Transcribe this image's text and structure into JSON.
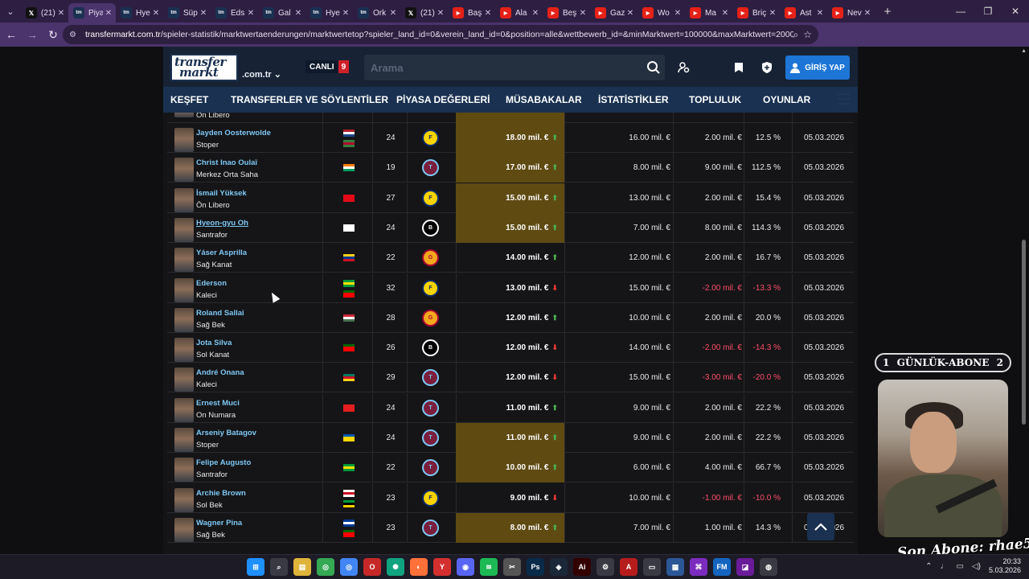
{
  "browser": {
    "tabs": [
      {
        "label": "(21)",
        "icon": "x-icon"
      },
      {
        "label": "Piya",
        "icon": "transfermarkt-icon",
        "active": true
      },
      {
        "label": "Hye",
        "icon": "transfermarkt-icon"
      },
      {
        "label": "Süp",
        "icon": "transfermarkt-icon"
      },
      {
        "label": "Eds",
        "icon": "transfermarkt-icon"
      },
      {
        "label": "Gal",
        "icon": "transfermarkt-icon"
      },
      {
        "label": "Hye",
        "icon": "transfermarkt-icon"
      },
      {
        "label": "Ork",
        "icon": "transfermarkt-icon"
      },
      {
        "label": "(21)",
        "icon": "x-icon"
      },
      {
        "label": "Baş",
        "icon": "youtube-icon"
      },
      {
        "label": "Ala",
        "icon": "youtube-icon"
      },
      {
        "label": "Beş",
        "icon": "youtube-icon"
      },
      {
        "label": "Gaz",
        "icon": "youtube-icon"
      },
      {
        "label": "Wo",
        "icon": "youtube-icon"
      },
      {
        "label": "Ma",
        "icon": "youtube-icon"
      },
      {
        "label": "Briç",
        "icon": "youtube-icon"
      },
      {
        "label": "Ast",
        "icon": "youtube-icon"
      },
      {
        "label": "Nev",
        "icon": "youtube-icon"
      }
    ],
    "url_host": "transfermarkt.com.tr",
    "url_path": "/spieler-statistik/marktwertaenderungen/marktwertetop?spieler_land_id=0&verein_land_id=0&position=alle&wettbewerb_id=&minMarktwert=100000&maxMarktwert=200000000&minAl..."
  },
  "header": {
    "logo_line1": "transfer",
    "logo_line2": "markt",
    "domain": ".com.tr",
    "live_label": "CANLI",
    "live_count": "9",
    "search_placeholder": "Arama",
    "login_label": "GİRİŞ YAP"
  },
  "nav": [
    "KEŞFET",
    "TRANSFERLER VE SÖYLENTİLER",
    "PİYASA DEĞERLERİ",
    "MÜSABAKALAR",
    "İSTATİSTİKLER",
    "TOPLULUK",
    "OYUNLAR"
  ],
  "partial_row": {
    "position": "Ön Libero"
  },
  "players": [
    {
      "name": "Jayden Oosterwolde",
      "position": "Stoper",
      "flags": [
        "netherlands",
        "suriname"
      ],
      "age": "24",
      "club": "fenerbahce",
      "value": "18.00 mil. €",
      "trend": "up",
      "highlight": true,
      "previous": "16.00 mil. €",
      "diff": "2.00 mil. €",
      "pct": "12.5 %",
      "date": "05.03.2026"
    },
    {
      "name": "Christ Inao Oulaï",
      "position": "Merkez Orta Saha",
      "flags": [
        "ivory-coast"
      ],
      "age": "19",
      "club": "trabzonspor",
      "value": "17.00 mil. €",
      "trend": "up",
      "highlight": true,
      "previous": "8.00 mil. €",
      "diff": "9.00 mil. €",
      "pct": "112.5 %",
      "date": "05.03.2026"
    },
    {
      "name": "İsmail Yüksek",
      "position": "Ön Libero",
      "flags": [
        "turkey"
      ],
      "age": "27",
      "club": "fenerbahce",
      "value": "15.00 mil. €",
      "trend": "up",
      "highlight": true,
      "previous": "13.00 mil. €",
      "diff": "2.00 mil. €",
      "pct": "15.4 %",
      "date": "05.03.2026"
    },
    {
      "name": "Hyeon-gyu Oh",
      "position": "Santrafor",
      "flags": [
        "korea"
      ],
      "age": "24",
      "club": "besiktas",
      "value": "15.00 mil. €",
      "trend": "up",
      "highlight": true,
      "previous": "7.00 mil. €",
      "diff": "8.00 mil. €",
      "pct": "114.3 %",
      "date": "05.03.2026",
      "underline": true
    },
    {
      "name": "Yáser Asprilla",
      "position": "Sağ Kanat",
      "flags": [
        "colombia"
      ],
      "age": "22",
      "club": "galatasaray",
      "value": "14.00 mil. €",
      "trend": "up",
      "highlight": false,
      "previous": "12.00 mil. €",
      "diff": "2.00 mil. €",
      "pct": "16.7 %",
      "date": "05.03.2026"
    },
    {
      "name": "Ederson",
      "position": "Kaleci",
      "flags": [
        "brazil",
        "portugal"
      ],
      "age": "32",
      "club": "fenerbahce",
      "value": "13.00 mil. €",
      "trend": "down",
      "highlight": false,
      "previous": "15.00 mil. €",
      "diff": "-2.00 mil. €",
      "pct": "-13.3 %",
      "date": "05.03.2026"
    },
    {
      "name": "Roland Sallai",
      "position": "Sağ Bek",
      "flags": [
        "hungary"
      ],
      "age": "28",
      "club": "galatasaray",
      "value": "12.00 mil. €",
      "trend": "up",
      "highlight": false,
      "previous": "10.00 mil. €",
      "diff": "2.00 mil. €",
      "pct": "20.0 %",
      "date": "05.03.2026"
    },
    {
      "name": "Jota Silva",
      "position": "Sol Kanat",
      "flags": [
        "portugal"
      ],
      "age": "26",
      "club": "besiktas",
      "value": "12.00 mil. €",
      "trend": "down",
      "highlight": false,
      "previous": "14.00 mil. €",
      "diff": "-2.00 mil. €",
      "pct": "-14.3 %",
      "date": "05.03.2026"
    },
    {
      "name": "André Onana",
      "position": "Kaleci",
      "flags": [
        "cameroon"
      ],
      "age": "29",
      "club": "trabzonspor",
      "value": "12.00 mil. €",
      "trend": "down",
      "highlight": false,
      "previous": "15.00 mil. €",
      "diff": "-3.00 mil. €",
      "pct": "-20.0 %",
      "date": "05.03.2026"
    },
    {
      "name": "Ernest Muci",
      "position": "On Numara",
      "flags": [
        "albania"
      ],
      "age": "24",
      "club": "trabzonspor",
      "value": "11.00 mil. €",
      "trend": "up",
      "highlight": false,
      "previous": "9.00 mil. €",
      "diff": "2.00 mil. €",
      "pct": "22.2 %",
      "date": "05.03.2026"
    },
    {
      "name": "Arseniy Batagov",
      "position": "Stoper",
      "flags": [
        "ukraine"
      ],
      "age": "24",
      "club": "trabzonspor",
      "value": "11.00 mil. €",
      "trend": "up",
      "highlight": true,
      "previous": "9.00 mil. €",
      "diff": "2.00 mil. €",
      "pct": "22.2 %",
      "date": "05.03.2026"
    },
    {
      "name": "Felipe Augusto",
      "position": "Santrafor",
      "flags": [
        "brazil"
      ],
      "age": "22",
      "club": "trabzonspor",
      "value": "10.00 mil. €",
      "trend": "up",
      "highlight": true,
      "previous": "6.00 mil. €",
      "diff": "4.00 mil. €",
      "pct": "66.7 %",
      "date": "05.03.2026"
    },
    {
      "name": "Archie Brown",
      "position": "Sol Bek",
      "flags": [
        "england",
        "jamaica"
      ],
      "age": "23",
      "club": "fenerbahce",
      "value": "9.00 mil. €",
      "trend": "down",
      "highlight": false,
      "previous": "10.00 mil. €",
      "diff": "-1.00 mil. €",
      "pct": "-10.0 %",
      "date": "05.03.2026"
    },
    {
      "name": "Wagner Pina",
      "position": "Sağ Bek",
      "flags": [
        "cape-verde",
        "portugal"
      ],
      "age": "23",
      "club": "trabzonspor",
      "value": "8.00 mil. €",
      "trend": "up",
      "highlight": true,
      "previous": "7.00 mil. €",
      "diff": "1.00 mil. €",
      "pct": "14.3 %",
      "date": "05.03.2026"
    }
  ],
  "overlay": {
    "badge_left": "1",
    "badge_text": "GÜNLÜK-ABONE",
    "badge_right": "2",
    "signature": "Son Abone: rhae5"
  },
  "taskbar": {
    "time": "20:33",
    "date": "5.03.2026"
  },
  "colors": {
    "highlight_value": "#5f4a12",
    "link_blue": "#7ec8f5",
    "negative": "#ff4d6a",
    "trend_up": "#4caf50",
    "trend_down": "#e53935",
    "nav_bg": "#1a3151",
    "login_bg": "#1d75d6"
  }
}
